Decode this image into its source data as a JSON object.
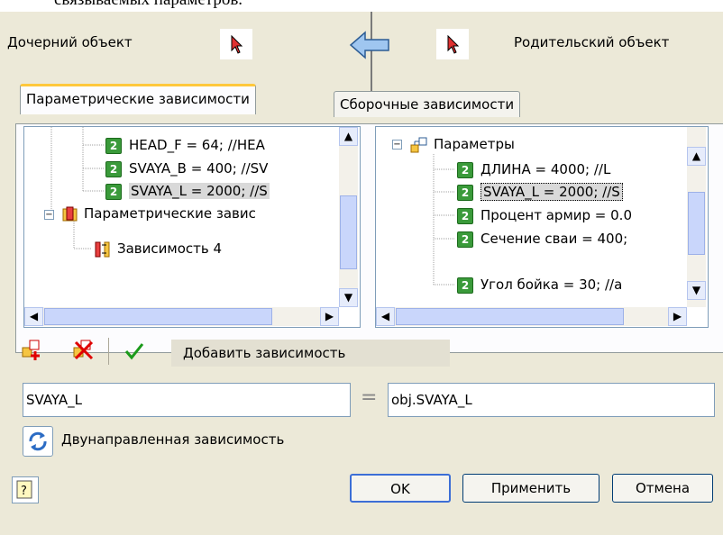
{
  "caption": "связываемых параметров.",
  "header": {
    "child_label": "Дочерний объект",
    "parent_label": "Родительский объект",
    "arrow_icon": "arrow-left-icon"
  },
  "tabs": [
    {
      "label": "Параметрические зависимости",
      "active": true
    },
    {
      "label": "Сборочные зависимости",
      "active": false
    }
  ],
  "left_tree": {
    "items": [
      {
        "text": "HEAD_F = 64; //HEA"
      },
      {
        "text": "SVAYA_B = 400; //SV"
      },
      {
        "text": "SVAYA_L = 2000; //S"
      },
      {
        "text": "Параметрические завис"
      },
      {
        "text": "Зависимость 4"
      }
    ]
  },
  "right_tree": {
    "root": "Параметры",
    "items": [
      {
        "text": "ДЛИНА = 4000; //L"
      },
      {
        "text": "SVAYA_L = 2000; //S"
      },
      {
        "text": "Процент армир = 0.0"
      },
      {
        "text": "Сечение сваи = 400;"
      },
      {
        "text": "Угол бойка = 30; //a"
      }
    ]
  },
  "toolbar": {
    "add_dependency_label": "Добавить зависимость"
  },
  "expression": {
    "left_value": "SVAYA_L",
    "equals": "=",
    "right_value": "obj.SVAYA_L"
  },
  "bidirectional_label": "Двунаправленная зависимость",
  "buttons": {
    "ok": "OK",
    "apply": "Применить",
    "cancel": "Отмена"
  },
  "colors": {
    "dialog_bg": "#ece9d8",
    "tab_highlight": "#ffc83c",
    "tree_border": "#7f9db9",
    "arrow_fill": "#9fc6f0"
  }
}
